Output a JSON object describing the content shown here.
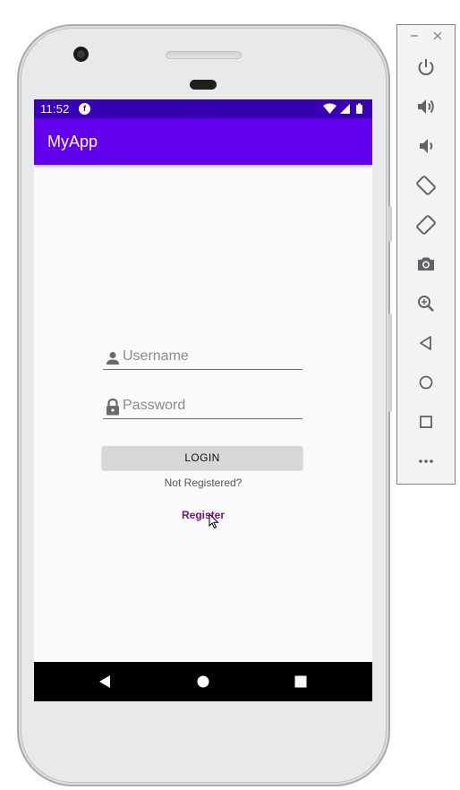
{
  "status_bar": {
    "time": "11:52",
    "app_icon_glyph": "f",
    "icons": [
      "wifi-icon",
      "cell-signal-icon",
      "battery-icon"
    ]
  },
  "app_bar": {
    "title": "MyApp"
  },
  "login_form": {
    "username": {
      "placeholder": "Username",
      "value": "",
      "icon": "person-icon"
    },
    "password": {
      "placeholder": "Password",
      "value": "",
      "icon": "lock-icon"
    },
    "login_label": "LOGIN",
    "not_registered_text": "Not Registered?",
    "register_label": "Register"
  },
  "nav_bar": {
    "buttons": [
      "back-icon",
      "home-icon",
      "recents-icon"
    ]
  },
  "emulator_toolbar": {
    "window_controls": [
      "minimize-icon",
      "close-icon"
    ],
    "buttons": [
      "power-icon",
      "volume-up-icon",
      "volume-down-icon",
      "rotate-left-icon",
      "rotate-right-icon",
      "camera-icon",
      "zoom-icon",
      "back-icon",
      "home-icon",
      "overview-icon",
      "more-icon"
    ]
  },
  "colors": {
    "status_bar": "#3700b3",
    "app_bar": "#6200ee",
    "register_link": "#7a0f7c",
    "button_background": "#d6d7d7"
  }
}
